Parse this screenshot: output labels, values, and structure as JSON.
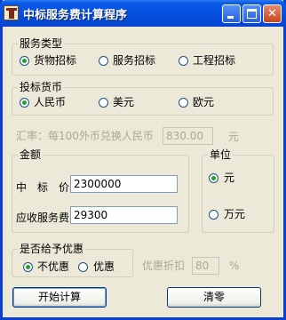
{
  "window": {
    "title": "中标服务费计算程序"
  },
  "service_type": {
    "title": "服务类型",
    "options": [
      "货物招标",
      "服务招标",
      "工程招标"
    ],
    "selected": 0
  },
  "currency": {
    "title": "投标货币",
    "options": [
      "人民币",
      "美元",
      "欧元"
    ],
    "selected": 0
  },
  "exchange_rate": {
    "label": "汇率：每100外币兑换人民币",
    "value": "830.00",
    "unit": "元"
  },
  "amount": {
    "title": "金额",
    "bid_price_label": "中　标　价",
    "bid_price_value": "2300000",
    "fee_label": "应收服务费",
    "fee_value": "29300"
  },
  "unit": {
    "title": "单位",
    "options": [
      "元",
      "万元"
    ],
    "selected": 0
  },
  "discount": {
    "title": "是否给予优惠",
    "options": [
      "不优惠",
      "优惠"
    ],
    "selected": 0,
    "rate_label": "优惠折扣",
    "rate_value": "80",
    "rate_unit": "%"
  },
  "buttons": {
    "calculate": "开始计算",
    "clear": "清零"
  }
}
